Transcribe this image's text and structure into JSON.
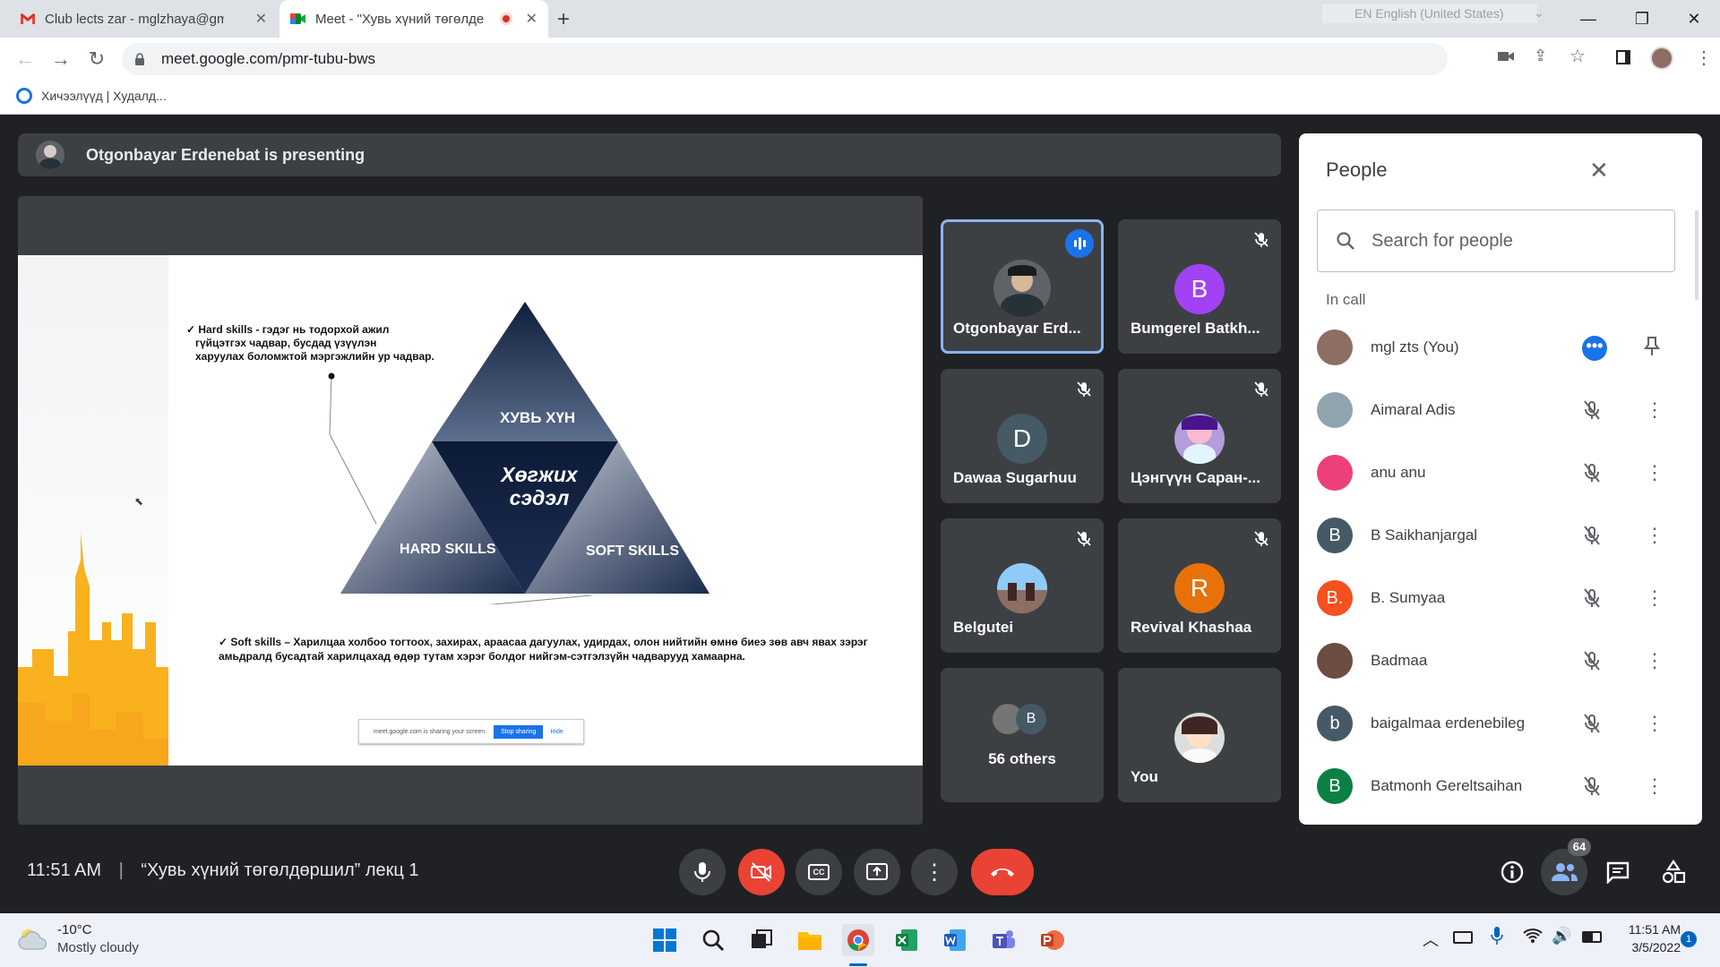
{
  "browser": {
    "tabs": [
      {
        "title": "Club lects zar - mglzhaya@gmail",
        "icon": "gmail-icon"
      },
      {
        "title": "Meet - \"Хувь хүний төгөлде",
        "icon": "meet-icon",
        "recording": true
      }
    ],
    "language_indicator": "EN English (United States)",
    "url": "meet.google.com/pmr-tubu-bws",
    "bookmark": "Хичээлүүд | Худалд..."
  },
  "meet": {
    "presenting_banner": "Otgonbayar Erdenebat is presenting",
    "slide": {
      "title": "ХУВЬ ХҮН",
      "center_line1": "Хөгжих",
      "center_line2": "сэдэл",
      "left_label": "HARD SKILLS",
      "right_label": "SOFT SKILLS",
      "hard_text1": "✓ Hard skills - гэдэг нь тодорхой ажил",
      "hard_text2": "гүйцэтгэх чадвар, бусдад үзүүлэн",
      "hard_text3": "харуулах боломжтой мэргэжлийн ур чадвар.",
      "soft_text1": "✓ Soft skills – Харилцаа холбоо тогтоох, захирах, араасаа дагуулах, удирдах, олон нийтийн өмнө биеэ зөв авч явах зэрэг",
      "soft_text2": "амьдралд бусадтай харилцахад өдөр тутам хэрэг болдог нийгэм-сэтгэлзүйн чадварууд хамаарна.",
      "share_bar_text": "meet.google.com is sharing your screen.",
      "share_stop": "Stop sharing",
      "share_hide": "Hide"
    },
    "tiles": [
      {
        "name": "Otgonbayar Erd...",
        "avatar": "photo",
        "speaking": true
      },
      {
        "name": "Bumgerel Batkh...",
        "letter": "B",
        "color": "#a142f4",
        "muted": true
      },
      {
        "name": "Dawaa Sugarhuu",
        "letter": "D",
        "color": "#455a64",
        "muted": true
      },
      {
        "name": "Цэнгүүн Саран-...",
        "avatar": "photo",
        "muted": true
      },
      {
        "name": "Belgutei",
        "avatar": "photo",
        "muted": true
      },
      {
        "name": "Revival Khashaa",
        "letter": "R",
        "color": "#e8710a",
        "muted": true
      },
      {
        "name": "56 others",
        "letter": "B"
      },
      {
        "name": "You",
        "avatar": "photo"
      }
    ],
    "meeting_time": "11:51 AM",
    "meeting_title": "“Хувь хүний төгөлдөршил” лекц 1",
    "participant_count": "64"
  },
  "people_panel": {
    "title": "People",
    "search_placeholder": "Search for people",
    "section": "In call",
    "people": [
      {
        "name": "mgl zts (You)",
        "avatar": "photo",
        "color": "#8d6e63"
      },
      {
        "name": "Aimaral Adis",
        "avatar": "photo",
        "color": "#90a4ae"
      },
      {
        "name": "anu anu",
        "avatar": "photo",
        "color": "#ec407a"
      },
      {
        "name": "B Saikhanjargal",
        "letter": "B",
        "color": "#455a64"
      },
      {
        "name": "B. Sumyaa",
        "letter": "B.",
        "color": "#f4511e"
      },
      {
        "name": "Badmaa",
        "avatar": "photo",
        "color": "#6d4c41"
      },
      {
        "name": "baigalmaa erdenebileg",
        "letter": "b",
        "color": "#455a64"
      },
      {
        "name": "Batmonh Gereltsaihan",
        "letter": "B",
        "color": "#0b8043"
      }
    ]
  },
  "taskbar": {
    "temperature": "-10°C",
    "weather": "Mostly cloudy",
    "time": "11:51 AM",
    "date": "3/5/2022",
    "notifications": "1"
  }
}
